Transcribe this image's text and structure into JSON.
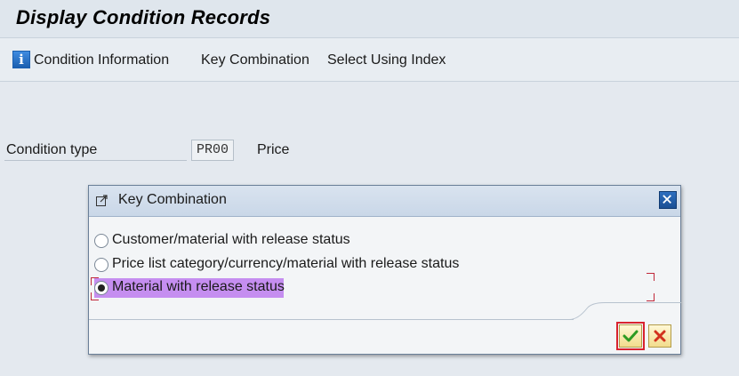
{
  "window": {
    "title": "Display Condition Records"
  },
  "toolbar": {
    "items": [
      {
        "label": "Condition Information",
        "icon": "info-icon"
      },
      {
        "label": "Key Combination"
      },
      {
        "label": "Select Using Index"
      }
    ]
  },
  "form": {
    "condition_type_label": "Condition type",
    "condition_type_value": "PR00",
    "condition_type_desc": "Price"
  },
  "dialog": {
    "title": "Key Combination",
    "options": [
      {
        "label": "Customer/material with release status",
        "selected": false
      },
      {
        "label": "Price list category/currency/material with release status",
        "selected": false
      },
      {
        "label": "Material with release status",
        "selected": true
      }
    ],
    "buttons": {
      "ok_icon": "green-check-icon",
      "cancel_icon": "red-x-icon"
    }
  },
  "colors": {
    "selected_highlight": "#c58ef0",
    "focus_frame": "#d9232f",
    "check_green": "#2e9b23",
    "cancel_red": "#d2321e",
    "dialog_header": "#c9d7e8"
  }
}
